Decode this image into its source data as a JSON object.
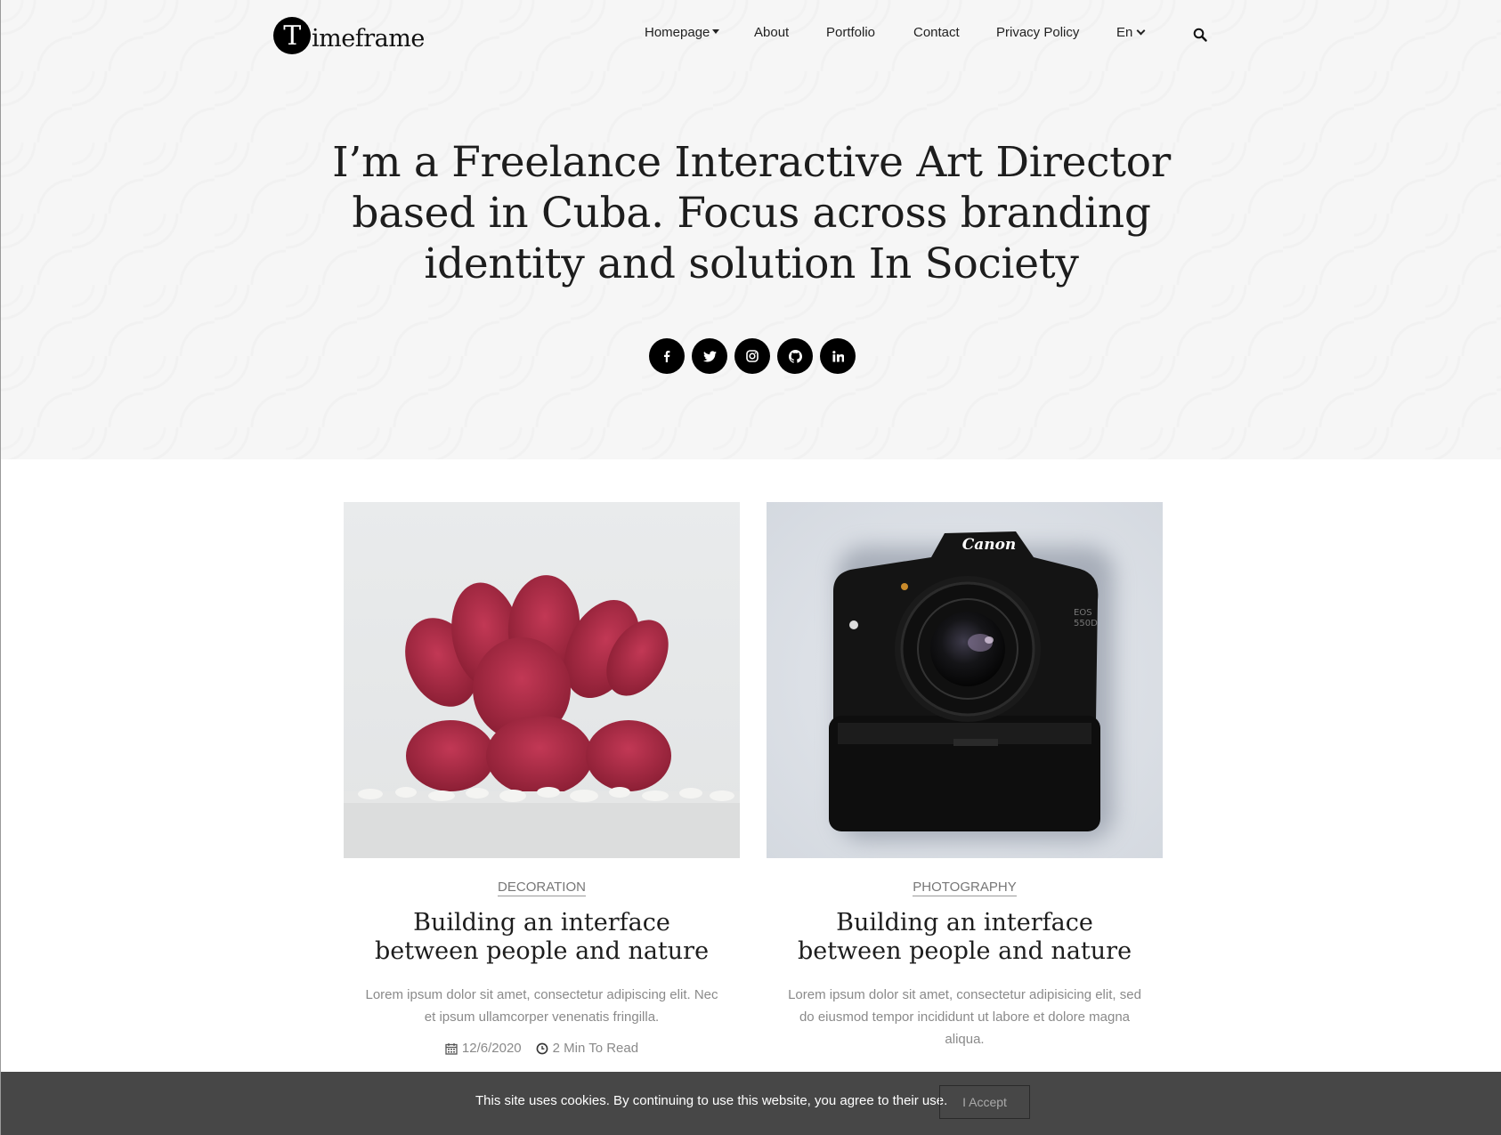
{
  "brand": {
    "logo_initial": "T",
    "logo_rest": "imeframe"
  },
  "nav": {
    "homepage": "Homepage",
    "about": "About",
    "portfolio": "Portfolio",
    "contact": "Contact",
    "privacy": "Privacy Policy",
    "language": "En"
  },
  "hero": {
    "title": "I’m a Freelance Interactive Art Director based in Cuba. Focus across branding identity and solution In Society",
    "socials": [
      "facebook-icon",
      "twitter-icon",
      "instagram-icon",
      "github-icon",
      "linkedin-icon"
    ]
  },
  "posts": [
    {
      "category": "DECORATION",
      "title": "Building an interface between people and nature",
      "excerpt": "Lorem ipsum dolor sit amet, consectetur adipiscing elit. Nec et ipsum ullamcorper venenatis fringilla.",
      "date": "12/6/2020",
      "read_time": "2 Min To Read",
      "image": "red-cactus-photo"
    },
    {
      "category": "PHOTOGRAPHY",
      "title": "Building an interface between people and nature",
      "excerpt": "Lorem ipsum dolor sit amet, consectetur adipisicing elit, sed do eiusmod tempor incididunt ut labore et dolore magna aliqua.",
      "image": "canon-camera-photo"
    }
  ],
  "cookie": {
    "message": "This site uses cookies. By continuing to use this website, you agree to their use.",
    "accept": "I Accept"
  }
}
